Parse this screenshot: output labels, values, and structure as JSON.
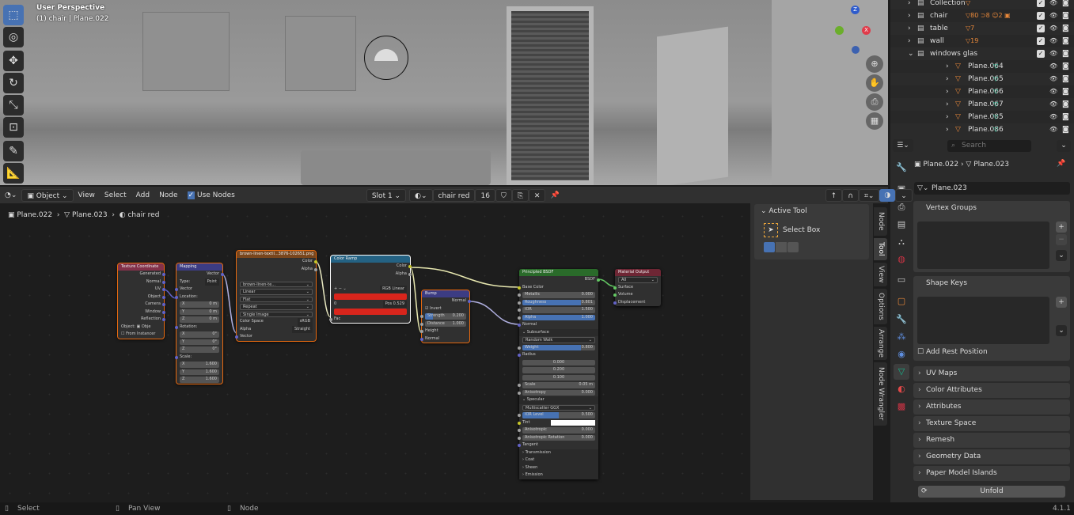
{
  "viewport": {
    "title": "User Perspective",
    "subtitle": "(1) chair | Plane.022",
    "tools": [
      "select-box",
      "cursor",
      "move",
      "rotate",
      "scale",
      "transform",
      "annotate",
      "measure"
    ],
    "axes": {
      "z": "Z",
      "x": "X",
      "y": "Y"
    }
  },
  "outliner": {
    "rows": [
      {
        "name": "Collection",
        "indent": 0,
        "expanded": false,
        "extra": "▽",
        "checkbox": true
      },
      {
        "name": "chair",
        "indent": 0,
        "expanded": false,
        "extra": "▽80 ⊃8 ☺2 ▣",
        "checkbox": true
      },
      {
        "name": "table",
        "indent": 0,
        "expanded": false,
        "extra": "▽7",
        "checkbox": true
      },
      {
        "name": "wall",
        "indent": 0,
        "expanded": false,
        "extra": "▽19",
        "checkbox": true
      },
      {
        "name": "windows glas",
        "indent": 0,
        "expanded": true,
        "extra": "",
        "checkbox": true
      },
      {
        "name": "Plane.064",
        "indent": 1,
        "expanded": false,
        "extra": "mesh"
      },
      {
        "name": "Plane.065",
        "indent": 1,
        "expanded": false,
        "extra": "mesh"
      },
      {
        "name": "Plane.066",
        "indent": 1,
        "expanded": false,
        "extra": "mesh"
      },
      {
        "name": "Plane.067",
        "indent": 1,
        "expanded": false,
        "extra": "mesh"
      },
      {
        "name": "Plane.085",
        "indent": 1,
        "expanded": false,
        "extra": "mesh"
      },
      {
        "name": "Plane.086",
        "indent": 1,
        "expanded": false,
        "extra": "mesh"
      }
    ]
  },
  "properties": {
    "search_placeholder": "Search",
    "breadcrumb_object": "Plane.022",
    "breadcrumb_mesh": "Plane.023",
    "mesh_name": "Plane.023",
    "panels": {
      "vertex_groups": "Vertex Groups",
      "shape_keys": "Shape Keys",
      "add_rest_position": "Add Rest Position"
    },
    "collapsed": [
      "UV Maps",
      "Color Attributes",
      "Attributes",
      "Texture Space",
      "Remesh",
      "Geometry Data",
      "Paper Model Islands"
    ],
    "unfold": "Unfold"
  },
  "header": {
    "editor_mode": "Object",
    "menus": [
      "View",
      "Select",
      "Add",
      "Node"
    ],
    "use_nodes": "Use Nodes",
    "slot": "Slot 1",
    "material": "chair red",
    "users": "16"
  },
  "breadcrumb": [
    "Plane.022",
    "Plane.023",
    "chair red"
  ],
  "npanel": {
    "title": "Active Tool",
    "tool": "Select Box",
    "tabs": [
      "Node",
      "Tool",
      "View",
      "Options",
      "Arrange",
      "Node Wrangler"
    ]
  },
  "nodes": [
    {
      "id": "texcoord",
      "title": "Texture Coordinate",
      "color": "#83314a",
      "rows": [
        {
          "t": "out",
          "l": "Generated"
        },
        {
          "t": "out",
          "l": "Normal"
        },
        {
          "t": "out",
          "l": "UV"
        },
        {
          "t": "out",
          "l": "Object"
        },
        {
          "t": "out",
          "l": "Camera"
        },
        {
          "t": "out",
          "l": "Window"
        },
        {
          "t": "out",
          "l": "Reflection"
        },
        {
          "t": "lbl",
          "l": "Object:  ▣ Obje"
        },
        {
          "t": "lbl",
          "l": "☐ From Instancer"
        }
      ]
    },
    {
      "id": "mapping",
      "title": "Mapping",
      "color": "#3c3c83",
      "rows": [
        {
          "t": "out",
          "l": "Vector"
        },
        {
          "t": "lbl",
          "l": "Type:",
          "v": "Point"
        },
        {
          "t": "in",
          "l": "Vector"
        },
        {
          "t": "in",
          "l": "Location:"
        },
        {
          "t": "fld",
          "l": "X",
          "v": "0 m"
        },
        {
          "t": "fld",
          "l": "Y",
          "v": "0 m"
        },
        {
          "t": "fld",
          "l": "Z",
          "v": "0 m"
        },
        {
          "t": "in",
          "l": "Rotation:"
        },
        {
          "t": "fld",
          "l": "X",
          "v": "0°"
        },
        {
          "t": "fld",
          "l": "Y",
          "v": "0°"
        },
        {
          "t": "fld",
          "l": "Z",
          "v": "0°"
        },
        {
          "t": "in",
          "l": "Scale:"
        },
        {
          "t": "fld",
          "l": "X",
          "v": "1.600"
        },
        {
          "t": "fld",
          "l": "Y",
          "v": "1.600"
        },
        {
          "t": "fld",
          "l": "Z",
          "v": "1.600"
        }
      ]
    },
    {
      "id": "image",
      "title": "brown-linen-textil...3876-102651.png",
      "color": "#79461d",
      "rows": [
        {
          "t": "out",
          "l": "Color",
          "s": "#c7c729"
        },
        {
          "t": "out",
          "l": "Alpha",
          "s": "#a1a1a1"
        },
        {
          "t": "lbl",
          "l": ""
        },
        {
          "t": "drop",
          "l": "brown-linen-te..."
        },
        {
          "t": "drop",
          "l": "Linear"
        },
        {
          "t": "drop",
          "l": "Flat"
        },
        {
          "t": "drop",
          "l": "Repeat"
        },
        {
          "t": "drop",
          "l": "Single Image"
        },
        {
          "t": "lbl",
          "l": "Color Space",
          "v": "sRGB"
        },
        {
          "t": "lbl",
          "l": "Alpha",
          "v": "Straight"
        },
        {
          "t": "in",
          "l": "Vector"
        }
      ]
    },
    {
      "id": "ramp",
      "title": "Color Ramp",
      "color": "#246283",
      "rows": [
        {
          "t": "out",
          "l": "Color",
          "s": "#c7c729"
        },
        {
          "t": "out",
          "l": "Alpha",
          "s": "#a1a1a1"
        },
        {
          "t": "lbl",
          "l": ""
        },
        {
          "t": "lbl",
          "l": "+  −  ⌄",
          "v": "RGB   Linear"
        },
        {
          "t": "ramp"
        },
        {
          "t": "lbl",
          "l": "0",
          "v": "Pos  0.529"
        },
        {
          "t": "swatch",
          "c": "#d9251c"
        },
        {
          "t": "in",
          "l": "Fac",
          "s": "#a1a1a1"
        }
      ]
    },
    {
      "id": "bump",
      "title": "Bump",
      "color": "#3c3c83",
      "rows": [
        {
          "t": "out",
          "l": "Normal"
        },
        {
          "t": "lbl",
          "l": "☑ Invert"
        },
        {
          "t": "fld",
          "l": "Strength",
          "v": "0.200",
          "f": 0.2,
          "s": "#a1a1a1"
        },
        {
          "t": "fld",
          "l": "Distance",
          "v": "1.000",
          "s": "#a1a1a1"
        },
        {
          "t": "in",
          "l": "Height",
          "s": "#a1a1a1"
        },
        {
          "t": "in",
          "l": "Normal"
        }
      ]
    },
    {
      "id": "bsdf",
      "title": "Principled BSDF",
      "color": "#2a6b2a",
      "rows": [
        {
          "t": "out",
          "l": "BSDF",
          "s": "#63c763"
        },
        {
          "t": "in",
          "l": "Base Color",
          "s": "#c7c729"
        },
        {
          "t": "fld",
          "l": "Metallic",
          "v": "0.000",
          "s": "#a1a1a1"
        },
        {
          "t": "fld",
          "l": "Roughness",
          "v": "0.801",
          "f": 0.801,
          "s": "#a1a1a1"
        },
        {
          "t": "fld",
          "l": "IOR",
          "v": "1.500",
          "s": "#a1a1a1"
        },
        {
          "t": "fld",
          "l": "Alpha",
          "v": "1.000",
          "f": 1,
          "s": "#a1a1a1"
        },
        {
          "t": "in",
          "l": "Normal"
        },
        {
          "t": "sec",
          "l": "⌄ Subsurface"
        },
        {
          "t": "drop",
          "l": "Random Walk"
        },
        {
          "t": "fld",
          "l": "Weight",
          "v": "0.800",
          "f": 0.8,
          "s": "#a1a1a1"
        },
        {
          "t": "in",
          "l": "Radius"
        },
        {
          "t": "fld",
          "l": "",
          "v": "",
          "c": "0.000"
        },
        {
          "t": "fld",
          "l": "",
          "v": "",
          "c": "0.200"
        },
        {
          "t": "fld",
          "l": "",
          "v": "",
          "c": "0.100"
        },
        {
          "t": "fld",
          "l": "Scale",
          "v": "0.05 m",
          "s": "#a1a1a1"
        },
        {
          "t": "fld",
          "l": "Anisotropy",
          "v": "0.000",
          "s": "#a1a1a1"
        },
        {
          "t": "sec",
          "l": "⌄ Specular"
        },
        {
          "t": "drop",
          "l": "Multiscatter GGX"
        },
        {
          "t": "fld",
          "l": "IOR Level",
          "v": "0.500",
          "f": 0.5,
          "s": "#a1a1a1"
        },
        {
          "t": "tint",
          "l": "Tint",
          "s": "#c7c729"
        },
        {
          "t": "fld",
          "l": "Anisotropic",
          "v": "0.000",
          "s": "#a1a1a1"
        },
        {
          "t": "fld",
          "l": "Anisotropic Rotation",
          "v": "0.000",
          "s": "#a1a1a1"
        },
        {
          "t": "in",
          "l": "Tangent"
        },
        {
          "t": "sec",
          "l": "› Transmission"
        },
        {
          "t": "sec",
          "l": "› Coat"
        },
        {
          "t": "sec",
          "l": "› Sheen"
        },
        {
          "t": "sec",
          "l": "› Emission"
        }
      ]
    },
    {
      "id": "output",
      "title": "Material Output",
      "color": "#6e2634",
      "rows": [
        {
          "t": "drop",
          "l": "All"
        },
        {
          "t": "in",
          "l": "Surface",
          "s": "#63c763"
        },
        {
          "t": "in",
          "l": "Volume",
          "s": "#63c763"
        },
        {
          "t": "in",
          "l": "Displacement"
        }
      ]
    }
  ],
  "status": {
    "select": "Select",
    "pan": "Pan View",
    "node": "Node",
    "version": "4.1.1"
  },
  "colors": {
    "accent": "#4772b3",
    "selected_outline": "#e86a10",
    "mesh_icon": "#e8883a",
    "mesh_data_icon": "#16b48a"
  }
}
